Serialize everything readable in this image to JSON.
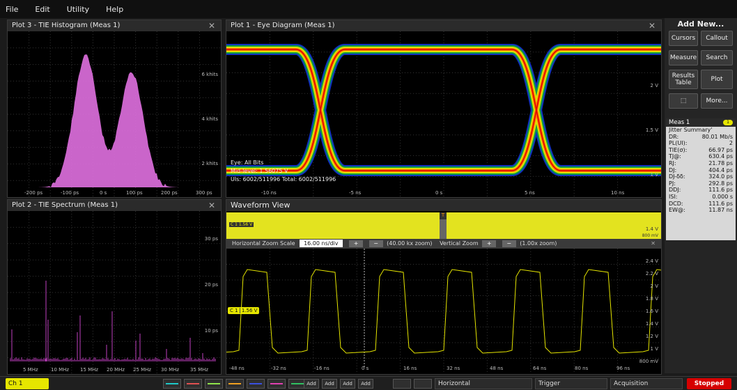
{
  "menu": [
    "File",
    "Edit",
    "Utility",
    "Help"
  ],
  "histogram": {
    "title": "Plot 3 - TIE Histogram (Meas 1)",
    "y_ticks": [
      "6 khits",
      "4 khits",
      "2 khits"
    ],
    "x_ticks": [
      "-200 ps",
      "-100 ps",
      "0 s",
      "100 ps",
      "200 ps",
      "300 ps"
    ],
    "color": "#e070e0"
  },
  "eye": {
    "title": "Plot 1 - Eye Diagram (Meas 1)",
    "y_ticks": [
      "2 V",
      "1.5 V",
      "1 V"
    ],
    "x_ticks": [
      "-10 ns",
      "-5 ns",
      "0 s",
      "5 ns",
      "10 ns"
    ],
    "info": [
      "Eye:  All Bits",
      "Mid-level:  1.56075 V",
      "UIs:  6002/511996   Total:  6002/511996"
    ]
  },
  "spectrum": {
    "title": "Plot 2 - TIE Spectrum (Meas 1)",
    "y_ticks": [
      "30 ps",
      "20 ps",
      "10 ps"
    ],
    "x_ticks": [
      "5 MHz",
      "10 MHz",
      "15 MHz",
      "20 MHz",
      "25 MHz",
      "30 MHz",
      "35 MHz"
    ]
  },
  "waveform": {
    "title": "Waveform View",
    "overview_label": "1.56 V",
    "overview_right": "1.4 V",
    "overview_bottom": "800 mV",
    "zoom": {
      "hscale_label": "Horizontal Zoom Scale",
      "hscale_value": "16.00 ns/div",
      "hzoom": "(40.00 kx zoom)",
      "vlabel": "Vertical Zoom",
      "vzoom": "(1.00x zoom)"
    },
    "c1_label": "C 1",
    "c1_value": "1.56 V",
    "y_ticks": [
      "2.4 V",
      "2.2 V",
      "2 V",
      "1.8 V",
      "1.6 V",
      "1.4 V",
      "1.2 V",
      "1 V",
      "800 mV"
    ],
    "x_ticks": [
      "-48 ns",
      "-32 ns",
      "-16 ns",
      "0 s",
      "16 ns",
      "32 ns",
      "48 ns",
      "64 ns",
      "80 ns",
      "96 ns"
    ]
  },
  "sidebar": {
    "add_new": "Add New...",
    "buttons": [
      "Cursors",
      "Callout",
      "Measure",
      "Search",
      "Results Table",
      "Plot",
      "More..."
    ],
    "meas": {
      "title": "Meas 1",
      "badge": "1",
      "subtitle": "Jitter Summary'",
      "rows": [
        [
          "DR:",
          "80.01 Mb/s"
        ],
        [
          "PL(UI):",
          "2"
        ],
        [
          "TIE(σ):",
          "66.97 ps"
        ],
        [
          "TJ@:",
          "630.4 ps"
        ],
        [
          "RJ:",
          "21.78 ps"
        ],
        [
          "DJ:",
          "404.4 ps"
        ],
        [
          "DJ-δδ:",
          "324.0 ps"
        ],
        [
          "PJ:",
          "292.8 ps"
        ],
        [
          "DDJ:",
          "111.6 ps"
        ],
        [
          "ISI:",
          "0.000 s"
        ],
        [
          "DCD:",
          "111.6 ps"
        ],
        [
          "EW@:",
          "11.87 ns"
        ]
      ]
    }
  },
  "bottom": {
    "channel": "Ch 1",
    "add": [
      "Add",
      "Add",
      "Add",
      "Add"
    ],
    "sections": [
      "Horizontal",
      "Trigger",
      "Acquisition"
    ],
    "status": "Stopped"
  }
}
